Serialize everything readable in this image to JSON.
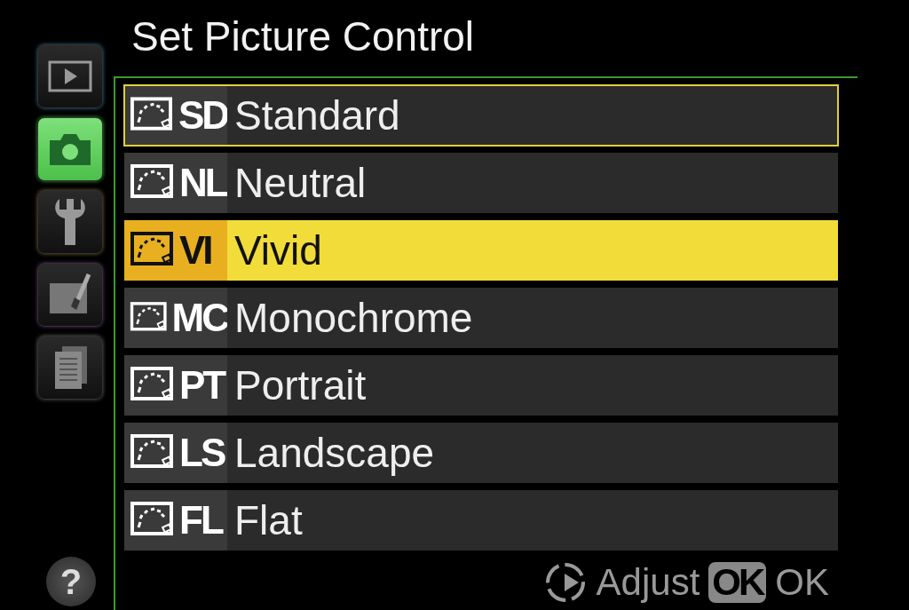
{
  "title": "Set Picture Control",
  "tabs": [
    {
      "kind": "playback",
      "selected": false
    },
    {
      "kind": "shooting",
      "selected": true
    },
    {
      "kind": "setup",
      "selected": false
    },
    {
      "kind": "retouch",
      "selected": false
    },
    {
      "kind": "recent",
      "selected": false
    }
  ],
  "options": [
    {
      "code": "SD",
      "label": "Standard",
      "current": true,
      "selected": false
    },
    {
      "code": "NL",
      "label": "Neutral",
      "current": false,
      "selected": false
    },
    {
      "code": "VI",
      "label": "Vivid",
      "current": false,
      "selected": true
    },
    {
      "code": "MC",
      "label": "Monochrome",
      "current": false,
      "selected": false
    },
    {
      "code": "PT",
      "label": "Portrait",
      "current": false,
      "selected": false
    },
    {
      "code": "LS",
      "label": "Landscape",
      "current": false,
      "selected": false
    },
    {
      "code": "FL",
      "label": "Flat",
      "current": false,
      "selected": false
    }
  ],
  "footer": {
    "adjust": "Adjust",
    "ok_key": "OK",
    "ok": "OK"
  },
  "help": "?"
}
